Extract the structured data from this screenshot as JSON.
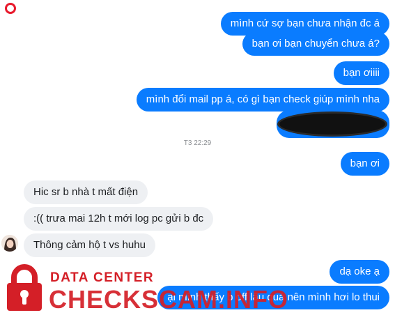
{
  "messages_top": [
    {
      "text": "mình cứ sợ bạn chưa nhận đc á"
    },
    {
      "text": "bạn ơi bạn chuyển chưa á?"
    },
    {
      "text": "bạn ơiiii"
    },
    {
      "text": "mình đổi mail pp á, có gì bạn check giúp mình nha"
    }
  ],
  "timestamp": "T3 22:29",
  "messages_after_time": {
    "out1": "bạn ơi"
  },
  "incoming": [
    {
      "text": "Hic sr b nhà t mất điện"
    },
    {
      "text": ":(( trưa mai 12h t mới log pc gửi b đc"
    },
    {
      "text": "Thông cảm hộ t vs huhu"
    }
  ],
  "messages_bottom": [
    {
      "text": "dạ oke ạ"
    },
    {
      "text": "ại mình thấy b off lâu quá nên mình hơi lo thui"
    }
  ],
  "watermark": {
    "line1": "DATA CENTER",
    "line2": "CHECKSCAM.INFO"
  },
  "colors": {
    "outgoing": "#0a7cff",
    "incoming": "#eef0f3",
    "watermark": "#d41f27"
  }
}
